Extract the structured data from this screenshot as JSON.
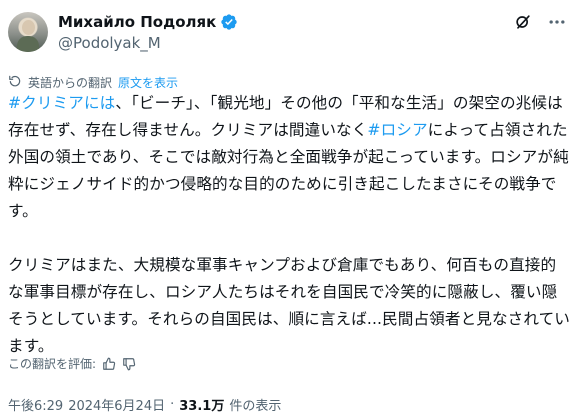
{
  "author": {
    "display_name": "Михайло Подоляк",
    "handle": "@Podolyak_M"
  },
  "icons": {
    "verified": "verified-badge-icon",
    "grok": "grok-icon",
    "more": "more-options-icon",
    "translate": "translate-icon",
    "thumbs_up": "thumbs-up-icon",
    "thumbs_down": "thumbs-down-icon"
  },
  "colors": {
    "link": "#1d9bf0",
    "text": "#0f1419",
    "muted": "#536471"
  },
  "translation": {
    "note": "英語からの翻訳",
    "show_original": "原文を表示"
  },
  "body": {
    "p1": [
      {
        "text": "#クリミアには",
        "type": "hashtag"
      },
      {
        "text": "、「ビーチ」、「観光地」その他の「平和な生活」の架空の兆候は存在せず、存在し得ません。クリミアは間違いなく",
        "type": "text"
      },
      {
        "text": "#ロシア",
        "type": "hashtag"
      },
      {
        "text": "によって占領された外国の領土であり、そこでは敵対行為と全面戦争が起こっています。ロシアが純粋にジェノサイド的かつ侵略的な目的のために引き起こしたまさにその戦争です。",
        "type": "text"
      }
    ],
    "p2": "クリミアはまた、大規模な軍事キャンプおよび倉庫でもあり、何百もの直接的な軍事目標が存在し、ロシア人たちはそれを自国民で冷笑的に隠蔽し、覆い隠そうとしています。それらの自国民は、順に言えば...民間占領者と見なされています。"
  },
  "rating": {
    "label": "この翻訳を評価:"
  },
  "meta": {
    "time": "午後6:29",
    "separator": "·",
    "date": "2024年6月24日",
    "views_count": "33.1万",
    "views_label": "件の表示"
  }
}
